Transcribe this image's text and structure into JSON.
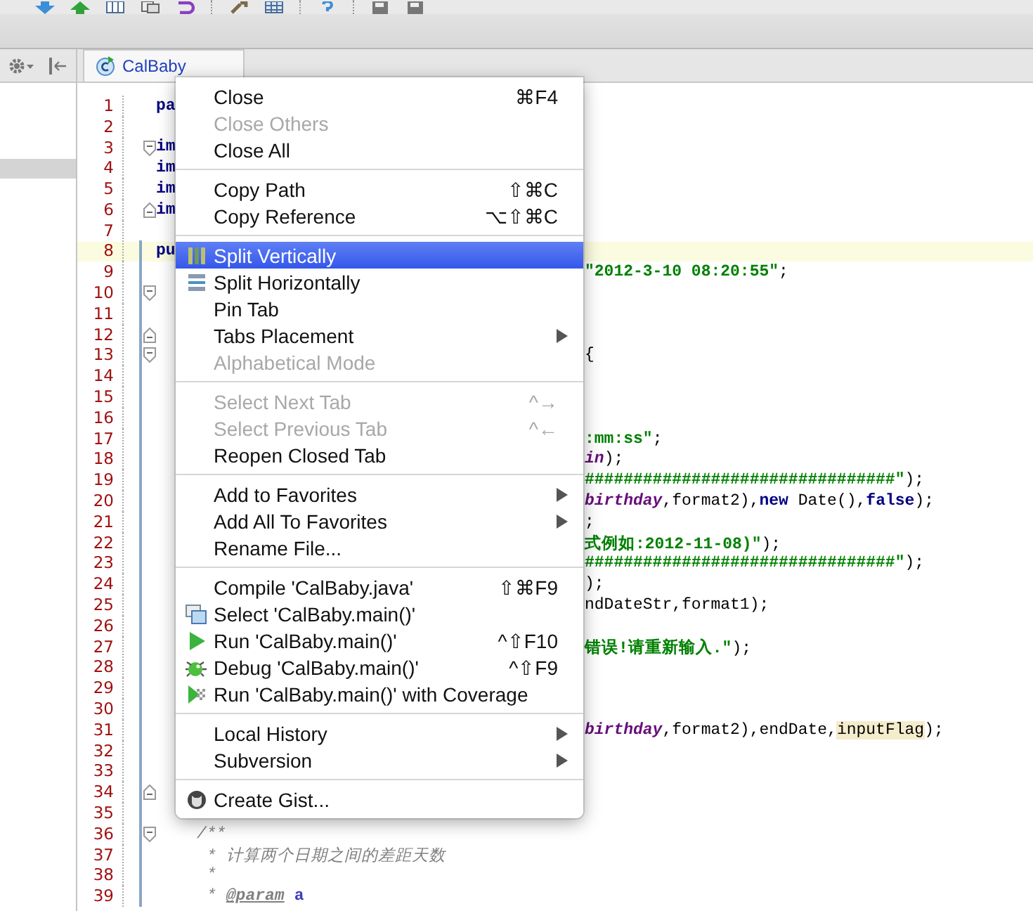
{
  "tab": {
    "label": "CalBaby",
    "selected": true
  },
  "editor": {
    "lines": [
      {
        "number": "1",
        "current": false,
        "changed": false,
        "left": [
          {
            "text": "pa",
            "kind": "keyword"
          }
        ]
      },
      {
        "number": "2",
        "current": false,
        "changed": false
      },
      {
        "number": "3",
        "current": false,
        "changed": false,
        "kind": "fold-start",
        "left": [
          {
            "text": "im",
            "kind": "keyword"
          }
        ]
      },
      {
        "number": "4",
        "current": false,
        "changed": false,
        "left": [
          {
            "text": "im",
            "kind": "keyword"
          }
        ]
      },
      {
        "number": "5",
        "current": false,
        "changed": false,
        "left": [
          {
            "text": "im",
            "kind": "keyword"
          }
        ]
      },
      {
        "number": "6",
        "current": false,
        "changed": false,
        "kind": "fold-end",
        "left": [
          {
            "text": "im",
            "kind": "keyword"
          }
        ]
      },
      {
        "number": "7",
        "current": false,
        "changed": false
      },
      {
        "number": "8",
        "current": true,
        "changed": true,
        "left": [
          {
            "text": "pu",
            "kind": "keyword"
          }
        ]
      },
      {
        "number": "9",
        "current": false,
        "changed": true,
        "right": [
          {
            "text": "\"2012-3-10 08:20:55\"",
            "kind": "string"
          },
          {
            "text": ";",
            "kind": "plain"
          }
        ]
      },
      {
        "number": "10",
        "current": false,
        "changed": true,
        "kind": "fold-start"
      },
      {
        "number": "11",
        "current": false,
        "changed": true
      },
      {
        "number": "12",
        "current": false,
        "changed": true,
        "kind": "fold-end"
      },
      {
        "number": "13",
        "current": false,
        "changed": true,
        "kind": "fold-start",
        "right": [
          {
            "text": "{",
            "kind": "plain"
          }
        ]
      },
      {
        "number": "14",
        "current": false,
        "changed": true
      },
      {
        "number": "15",
        "current": false,
        "changed": true
      },
      {
        "number": "16",
        "current": false,
        "changed": true
      },
      {
        "number": "17",
        "current": false,
        "changed": true,
        "right": [
          {
            "text": ":mm:ss\"",
            "kind": "string"
          },
          {
            "text": ";",
            "kind": "plain"
          }
        ]
      },
      {
        "number": "18",
        "current": false,
        "changed": true,
        "right": [
          {
            "text": "in",
            "kind": "field"
          },
          {
            "text": ");",
            "kind": "plain"
          }
        ]
      },
      {
        "number": "19",
        "current": false,
        "changed": true,
        "right": [
          {
            "text": "################################\"",
            "kind": "string"
          },
          {
            "text": ");",
            "kind": "plain"
          }
        ]
      },
      {
        "number": "20",
        "current": false,
        "changed": true,
        "right": [
          {
            "text": "birthday",
            "kind": "field"
          },
          {
            "text": ",format2),",
            "kind": "plain"
          },
          {
            "text": "new",
            "kind": "keyword"
          },
          {
            "text": " Date(),",
            "kind": "plain"
          },
          {
            "text": "false",
            "kind": "keyword"
          },
          {
            "text": ");",
            "kind": "plain"
          }
        ]
      },
      {
        "number": "21",
        "current": false,
        "changed": true,
        "right": [
          {
            "text": ";",
            "kind": "plain"
          }
        ]
      },
      {
        "number": "22",
        "current": false,
        "changed": true,
        "right": [
          {
            "text": "式例如:2012-11-08)\"",
            "kind": "string"
          },
          {
            "text": ");",
            "kind": "plain"
          }
        ]
      },
      {
        "number": "23",
        "current": false,
        "changed": true,
        "right": [
          {
            "text": "################################\"",
            "kind": "string"
          },
          {
            "text": ");",
            "kind": "plain"
          }
        ]
      },
      {
        "number": "24",
        "current": false,
        "changed": true,
        "right": [
          {
            "text": ");",
            "kind": "plain"
          }
        ]
      },
      {
        "number": "25",
        "current": false,
        "changed": true,
        "right": [
          {
            "text": "ndDateStr,format1);",
            "kind": "plain"
          }
        ]
      },
      {
        "number": "26",
        "current": false,
        "changed": true
      },
      {
        "number": "27",
        "current": false,
        "changed": true,
        "right": [
          {
            "text": "错误!请重新输入.\"",
            "kind": "string"
          },
          {
            "text": ");",
            "kind": "plain"
          }
        ]
      },
      {
        "number": "28",
        "current": false,
        "changed": true
      },
      {
        "number": "29",
        "current": false,
        "changed": true
      },
      {
        "number": "30",
        "current": false,
        "changed": true
      },
      {
        "number": "31",
        "current": false,
        "changed": true,
        "right": [
          {
            "text": "birthday",
            "kind": "field"
          },
          {
            "text": ",format2),endDate,",
            "kind": "plain"
          },
          {
            "text": "inputFlag",
            "kind": "highlight"
          },
          {
            "text": ");",
            "kind": "plain"
          }
        ]
      },
      {
        "number": "32",
        "current": false,
        "changed": true
      },
      {
        "number": "33",
        "current": false,
        "changed": true
      },
      {
        "number": "34",
        "current": false,
        "changed": true,
        "kind": "fold-end"
      },
      {
        "number": "35",
        "current": false,
        "changed": true
      },
      {
        "number": "36",
        "current": false,
        "changed": true,
        "kind": "fold-start",
        "left": [
          {
            "text": "/**",
            "kind": "doc-start"
          }
        ]
      },
      {
        "number": "37",
        "current": false,
        "changed": true,
        "left": [
          {
            "text": "* 计算两个日期之间的差距天数",
            "kind": "doc"
          }
        ]
      },
      {
        "number": "38",
        "current": false,
        "changed": true,
        "left": [
          {
            "text": "*",
            "kind": "doc"
          }
        ]
      },
      {
        "number": "39",
        "current": false,
        "changed": true,
        "left": [
          {
            "text": "*",
            "kind": "doc"
          },
          {
            "text": "@param",
            "kind": "doctag"
          },
          {
            "text": "a",
            "kind": "docparam"
          }
        ]
      }
    ]
  },
  "context_menu": {
    "items": [
      {
        "kind": "plain",
        "label": "Close",
        "shortcut": "⌘F4",
        "disabled": false,
        "selected": false,
        "submenu": false
      },
      {
        "kind": "plain",
        "label": "Close Others",
        "disabled": true,
        "selected": false,
        "submenu": false
      },
      {
        "kind": "plain",
        "label": "Close All",
        "disabled": false,
        "selected": false,
        "submenu": false
      },
      {
        "kind": "separator"
      },
      {
        "kind": "plain",
        "label": "Copy Path",
        "shortcut": "⇧⌘C",
        "disabled": false,
        "selected": false,
        "submenu": false
      },
      {
        "kind": "plain",
        "label": "Copy Reference",
        "shortcut": "⌥⇧⌘C",
        "disabled": false,
        "selected": false,
        "submenu": false
      },
      {
        "kind": "separator"
      },
      {
        "kind": "split-vertical",
        "label": "Split Vertically",
        "disabled": false,
        "selected": true,
        "submenu": false
      },
      {
        "kind": "split-horizontal",
        "label": "Split Horizontally",
        "disabled": false,
        "selected": false,
        "submenu": false
      },
      {
        "kind": "plain",
        "label": "Pin Tab",
        "disabled": false,
        "selected": false,
        "submenu": false
      },
      {
        "kind": "plain",
        "label": "Tabs Placement",
        "disabled": false,
        "selected": false,
        "submenu": true
      },
      {
        "kind": "plain",
        "label": "Alphabetical Mode",
        "disabled": true,
        "selected": false,
        "submenu": false
      },
      {
        "kind": "separator"
      },
      {
        "kind": "plain",
        "label": "Select Next Tab",
        "shortcut": "^→",
        "disabled": true,
        "selected": false,
        "submenu": false
      },
      {
        "kind": "plain",
        "label": "Select Previous Tab",
        "shortcut": "^←",
        "disabled": true,
        "selected": false,
        "submenu": false
      },
      {
        "kind": "plain",
        "label": "Reopen Closed Tab",
        "disabled": false,
        "selected": false,
        "submenu": false
      },
      {
        "kind": "separator"
      },
      {
        "kind": "plain",
        "label": "Add to Favorites",
        "disabled": false,
        "selected": false,
        "submenu": true
      },
      {
        "kind": "plain",
        "label": "Add All To Favorites",
        "disabled": false,
        "selected": false,
        "submenu": true
      },
      {
        "kind": "plain",
        "label": "Rename File...",
        "disabled": false,
        "selected": false,
        "submenu": false
      },
      {
        "kind": "separator"
      },
      {
        "kind": "plain",
        "label": "Compile 'CalBaby.java'",
        "shortcut": "⇧⌘F9",
        "disabled": false,
        "selected": false,
        "submenu": false
      },
      {
        "kind": "select",
        "label": "Select 'CalBaby.main()'",
        "disabled": false,
        "selected": false,
        "submenu": false
      },
      {
        "kind": "run",
        "label": "Run 'CalBaby.main()'",
        "shortcut": "^⇧F10",
        "disabled": false,
        "selected": false,
        "submenu": false
      },
      {
        "kind": "debug",
        "label": "Debug 'CalBaby.main()'",
        "shortcut": "^⇧F9",
        "disabled": false,
        "selected": false,
        "submenu": false
      },
      {
        "kind": "coverage",
        "label": "Run 'CalBaby.main()' with Coverage",
        "disabled": false,
        "selected": false,
        "submenu": false
      },
      {
        "kind": "separator"
      },
      {
        "kind": "plain",
        "label": "Local History",
        "disabled": false,
        "selected": false,
        "submenu": true
      },
      {
        "kind": "plain",
        "label": "Subversion",
        "disabled": false,
        "selected": false,
        "submenu": true
      },
      {
        "kind": "separator"
      },
      {
        "kind": "gist",
        "label": "Create Gist...",
        "disabled": false,
        "selected": false,
        "submenu": false
      }
    ]
  }
}
